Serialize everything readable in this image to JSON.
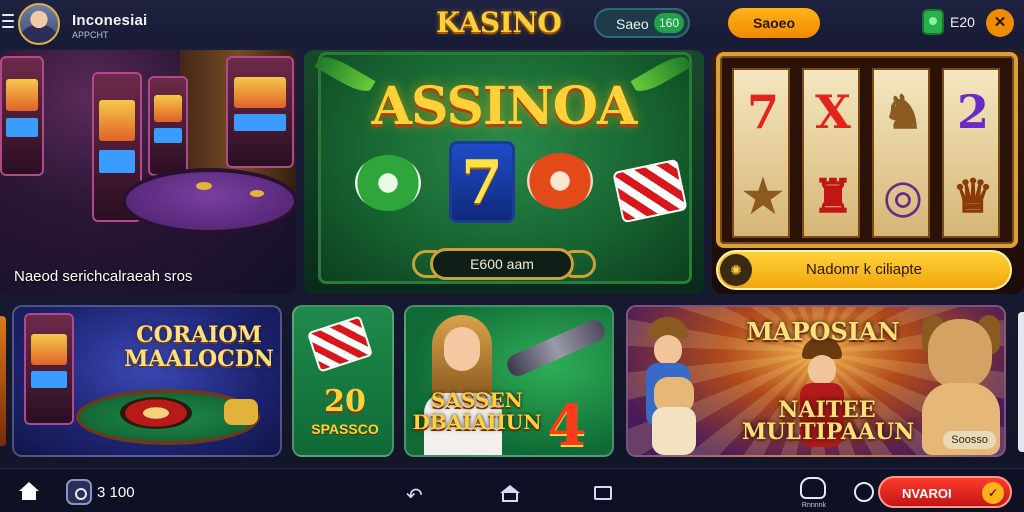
{
  "header": {
    "user_name": "Inconesiai",
    "user_subtitle": "APPCHT",
    "brand": "KASINO",
    "balance_label": "Saeo",
    "balance_chip": "160",
    "action_label": "Saoeo",
    "coins": "E20",
    "settings_glyph": "✕"
  },
  "banners": {
    "left_caption": "Naeod serichcalraeah sros",
    "center_title": "ASSINOA",
    "center_seven": "7",
    "center_button": "E600 aam",
    "right_action": "Nadomr k ciliapte",
    "right_icon_glyph": "✺",
    "right_reel_symbols": [
      [
        "7",
        "★"
      ],
      [
        "X",
        "♜"
      ],
      [
        "♞",
        "◎"
      ],
      [
        "2",
        "♛"
      ]
    ]
  },
  "tiles": {
    "tile1_title": "CORAIOM MAALOCDN",
    "tile2_title": "20",
    "tile2_sub": "SPASSCO",
    "tile3_title": "SASSEN DBAIAIIUN",
    "tile3_number": "4",
    "tile4_title": "MAPOSIAN",
    "tile4_sub": "NAITEE MULTIPAAUN",
    "tile4_pill": "Soosso"
  },
  "bottom_nav": {
    "wallet_value": "3 100",
    "back_glyph": "↶",
    "dog_label": "Rnnnnk",
    "cta_label": "NVAROI",
    "cta_glyph": "✓"
  },
  "icons": [
    "menu-icon",
    "avatar",
    "coin-icon",
    "settings-icon",
    "home-icon",
    "wallet-icon",
    "back-icon",
    "nav-home-icon",
    "recent-apps-icon",
    "dog-icon",
    "support-icon",
    "check-icon"
  ],
  "colors": {
    "accent": "#f08a00",
    "cta": "#e0221a",
    "brand_gold": "#ffcf3a"
  }
}
